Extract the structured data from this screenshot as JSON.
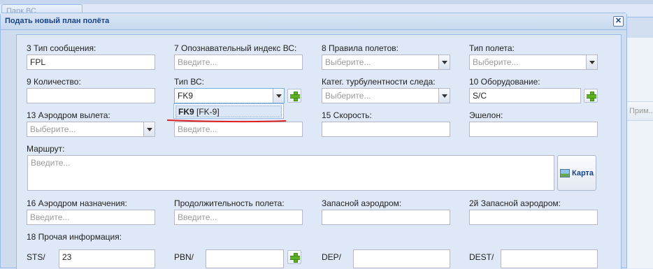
{
  "background": {
    "tab_label": "Парк ВС",
    "right_header": "Прим..."
  },
  "window": {
    "title": "Подать новый план полёта",
    "close_glyph": "✕"
  },
  "fields": {
    "msg_type": {
      "label": "3 Тип сообщения:",
      "value": "FPL"
    },
    "aircraft_id": {
      "label": "7 Опознавательный индекс ВС:",
      "placeholder": "Введите..."
    },
    "flight_rules": {
      "label": "8 Правила полетов:",
      "placeholder": "Выберите..."
    },
    "flight_type": {
      "label": "Тип полета:",
      "placeholder": "Выберите..."
    },
    "number": {
      "label": "9 Количество:",
      "value": ""
    },
    "aircraft_type": {
      "label": "Тип ВС:",
      "value": "FK9"
    },
    "wake_cat": {
      "label": "Катег. турбулентности следа:",
      "placeholder": "Выберите..."
    },
    "equipment": {
      "label": "10 Оборудование:",
      "value": "S/C"
    },
    "dep_aerodrome": {
      "label": "13 Аэродром вылета:",
      "placeholder": "Выберите..."
    },
    "dep_time": {
      "placeholder": "Введите..."
    },
    "speed": {
      "label": "15 Скорость:",
      "value": ""
    },
    "level": {
      "label": "Эшелон:",
      "value": ""
    },
    "route": {
      "label": "Маршрут:",
      "placeholder": "Введите..."
    },
    "dest_aerodrome": {
      "label": "16 Аэродром назначения:",
      "placeholder": "Введите..."
    },
    "duration": {
      "label": "Продолжительность полета:",
      "placeholder": "Введите..."
    },
    "alternate": {
      "label": "Запасной аэродром:",
      "value": ""
    },
    "alternate2": {
      "label": "2й Запасной аэродром:",
      "value": ""
    },
    "other_info": {
      "label": "18 Прочая информация:"
    },
    "sts": {
      "label": "STS/",
      "value": "23"
    },
    "pbn": {
      "label": "PBN/",
      "value": ""
    },
    "dep": {
      "label": "DEP/",
      "value": ""
    },
    "dest": {
      "label": "DEST/",
      "value": ""
    }
  },
  "map_button": {
    "label": "Карта"
  },
  "dropdown": {
    "item_code": "FK9",
    "item_detail": " [FK-9]"
  },
  "colors": {
    "accent": "#15428b",
    "highlight_line": "#e02020"
  }
}
